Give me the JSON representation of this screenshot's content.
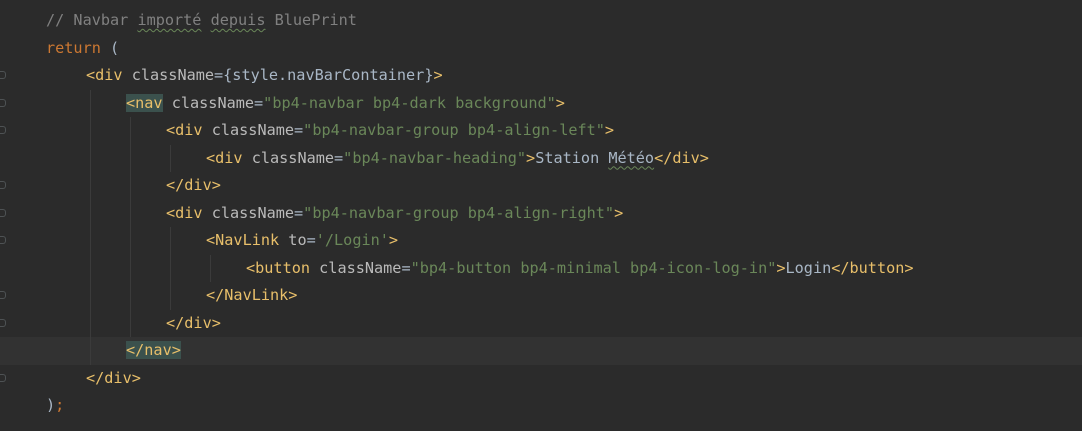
{
  "editor": {
    "theme": "darcula",
    "colors": {
      "background": "#2b2b2b",
      "current_line": "#323232",
      "comment": "#808080",
      "keyword": "#cc7832",
      "tag": "#e8bf6a",
      "attribute": "#bababa",
      "string": "#6a8759",
      "text": "#a9b7c6",
      "brace_match": "#3b514d"
    },
    "lines": [
      {
        "indent": 1,
        "tokens": [
          {
            "t": "// Navbar ",
            "c": "comment"
          },
          {
            "t": "importé",
            "c": "comment",
            "typo": true
          },
          {
            "t": " ",
            "c": "comment"
          },
          {
            "t": "depuis",
            "c": "comment",
            "typo": true
          },
          {
            "t": " BluePrint",
            "c": "comment"
          }
        ]
      },
      {
        "indent": 1,
        "tokens": [
          {
            "t": "return",
            "c": "keyword"
          },
          {
            "t": " (",
            "c": "punct"
          }
        ]
      },
      {
        "indent": 2,
        "tokens": [
          {
            "t": "<div",
            "c": "tag"
          },
          {
            "t": " className",
            "c": "attr"
          },
          {
            "t": "={style.navBarContainer}",
            "c": "punct"
          },
          {
            "t": ">",
            "c": "tag"
          }
        ]
      },
      {
        "indent": 3,
        "tokens": [
          {
            "t": "<nav",
            "c": "tag",
            "match": true
          },
          {
            "t": " className",
            "c": "attr"
          },
          {
            "t": "=",
            "c": "punct"
          },
          {
            "t": "\"bp4-navbar bp4-dark background\"",
            "c": "string"
          },
          {
            "t": ">",
            "c": "tag"
          }
        ]
      },
      {
        "indent": 4,
        "tokens": [
          {
            "t": "<div",
            "c": "tag"
          },
          {
            "t": " className",
            "c": "attr"
          },
          {
            "t": "=",
            "c": "punct"
          },
          {
            "t": "\"bp4-navbar-group bp4-align-left\"",
            "c": "string"
          },
          {
            "t": ">",
            "c": "tag"
          }
        ]
      },
      {
        "indent": 5,
        "tokens": [
          {
            "t": "<div",
            "c": "tag"
          },
          {
            "t": " className",
            "c": "attr"
          },
          {
            "t": "=",
            "c": "punct"
          },
          {
            "t": "\"bp4-navbar-heading\"",
            "c": "string"
          },
          {
            "t": ">",
            "c": "tag"
          },
          {
            "t": "Station ",
            "c": "text"
          },
          {
            "t": "Météo",
            "c": "text",
            "typo": true
          },
          {
            "t": "</div>",
            "c": "tag"
          }
        ]
      },
      {
        "indent": 4,
        "tokens": [
          {
            "t": "</div>",
            "c": "tag"
          }
        ]
      },
      {
        "indent": 4,
        "tokens": [
          {
            "t": "<div",
            "c": "tag"
          },
          {
            "t": " className",
            "c": "attr"
          },
          {
            "t": "=",
            "c": "punct"
          },
          {
            "t": "\"bp4-navbar-group bp4-align-right\"",
            "c": "string"
          },
          {
            "t": ">",
            "c": "tag"
          }
        ]
      },
      {
        "indent": 5,
        "tokens": [
          {
            "t": "<NavLink",
            "c": "tag"
          },
          {
            "t": " to",
            "c": "attr"
          },
          {
            "t": "=",
            "c": "punct"
          },
          {
            "t": "'/Login'",
            "c": "string"
          },
          {
            "t": ">",
            "c": "tag"
          }
        ]
      },
      {
        "indent": 6,
        "tokens": [
          {
            "t": "<button",
            "c": "tag"
          },
          {
            "t": " className",
            "c": "attr"
          },
          {
            "t": "=",
            "c": "punct"
          },
          {
            "t": "\"bp4-button bp4-minimal bp4-icon-log-in\"",
            "c": "string"
          },
          {
            "t": ">",
            "c": "tag"
          },
          {
            "t": "Login",
            "c": "text"
          },
          {
            "t": "</button>",
            "c": "tag"
          }
        ]
      },
      {
        "indent": 5,
        "tokens": [
          {
            "t": "</NavLink>",
            "c": "tag"
          }
        ]
      },
      {
        "indent": 4,
        "tokens": [
          {
            "t": "</div>",
            "c": "tag"
          }
        ]
      },
      {
        "indent": 3,
        "current": true,
        "tokens": [
          {
            "t": "</nav>",
            "c": "tag",
            "match": true
          }
        ]
      },
      {
        "indent": 2,
        "tokens": [
          {
            "t": "</div>",
            "c": "tag"
          }
        ]
      },
      {
        "indent": 1,
        "tokens": [
          {
            "t": ")",
            "c": "punct"
          },
          {
            "t": ";",
            "c": "semi"
          }
        ]
      }
    ]
  }
}
